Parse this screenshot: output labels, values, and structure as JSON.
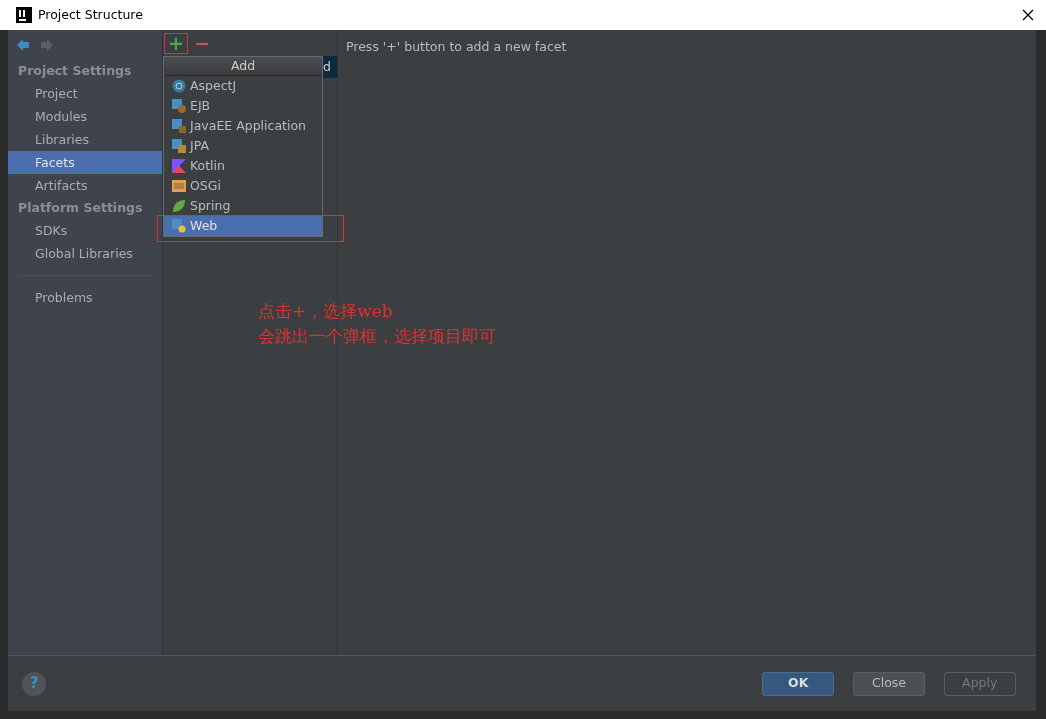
{
  "window": {
    "title": "Project Structure"
  },
  "sidebar": {
    "sections": [
      {
        "heading": "Project Settings",
        "items": [
          {
            "label": "Project",
            "selected": false
          },
          {
            "label": "Modules",
            "selected": false
          },
          {
            "label": "Libraries",
            "selected": false
          },
          {
            "label": "Facets",
            "selected": true
          },
          {
            "label": "Artifacts",
            "selected": false
          }
        ]
      },
      {
        "heading": "Platform Settings",
        "items": [
          {
            "label": "SDKs",
            "selected": false
          },
          {
            "label": "Global Libraries",
            "selected": false
          }
        ]
      }
    ],
    "bottom_items": [
      {
        "label": "Problems",
        "selected": false
      }
    ]
  },
  "toolbar": {
    "add": "+",
    "remove": "−"
  },
  "facets_list": [
    {
      "label": "d",
      "selected": true
    }
  ],
  "hint": "Press '+' button to add a new facet",
  "add_popup": {
    "title": "Add",
    "items": [
      {
        "label": "AspectJ",
        "kind": "aspectj",
        "selected": false
      },
      {
        "label": "EJB",
        "kind": "ejb",
        "selected": false
      },
      {
        "label": "JavaEE Application",
        "kind": "javaee",
        "selected": false
      },
      {
        "label": "JPA",
        "kind": "jpa",
        "selected": false
      },
      {
        "label": "Kotlin",
        "kind": "kotlin",
        "selected": false
      },
      {
        "label": "OSGi",
        "kind": "osgi",
        "selected": false
      },
      {
        "label": "Spring",
        "kind": "spring",
        "selected": false
      },
      {
        "label": "Web",
        "kind": "web",
        "selected": true
      }
    ]
  },
  "annotation": {
    "lines": [
      "点击+，选择web",
      "会跳出一个弹框，选择项目即可"
    ]
  },
  "footer": {
    "help": "?",
    "buttons": [
      {
        "label": "OK",
        "kind": "primary",
        "disabled": false
      },
      {
        "label": "Close",
        "kind": "default",
        "disabled": false
      },
      {
        "label": "Apply",
        "kind": "default",
        "disabled": true
      }
    ]
  }
}
